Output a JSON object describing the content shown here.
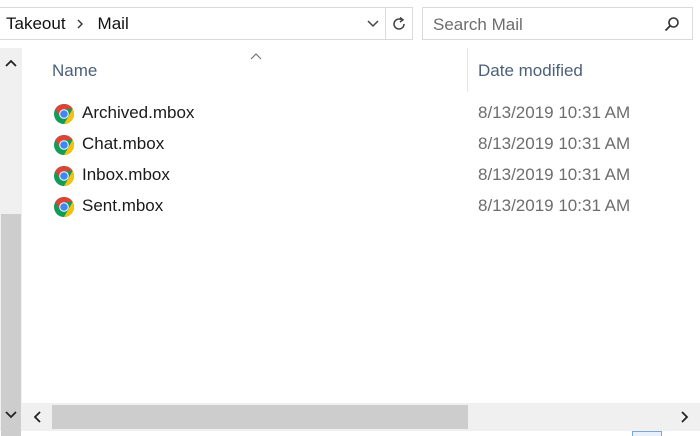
{
  "address_bar": {
    "breadcrumbs": [
      "Takeout",
      "Mail"
    ]
  },
  "search": {
    "placeholder": "Search Mail"
  },
  "columns": {
    "name": "Name",
    "date_modified": "Date modified"
  },
  "files": [
    {
      "name": "Archived.mbox",
      "date": "8/13/2019 10:31 AM",
      "icon": "chrome-icon"
    },
    {
      "name": "Chat.mbox",
      "date": "8/13/2019 10:31 AM",
      "icon": "chrome-icon"
    },
    {
      "name": "Inbox.mbox",
      "date": "8/13/2019 10:31 AM",
      "icon": "chrome-icon"
    },
    {
      "name": "Sent.mbox",
      "date": "8/13/2019 10:31 AM",
      "icon": "chrome-icon"
    }
  ],
  "colors": {
    "header_text": "#4c607a",
    "date_text": "#6d6d6d",
    "chrome_red": "#db4437",
    "chrome_yellow": "#f4c20d",
    "chrome_green": "#0f9d58",
    "chrome_blue": "#4285f4"
  }
}
